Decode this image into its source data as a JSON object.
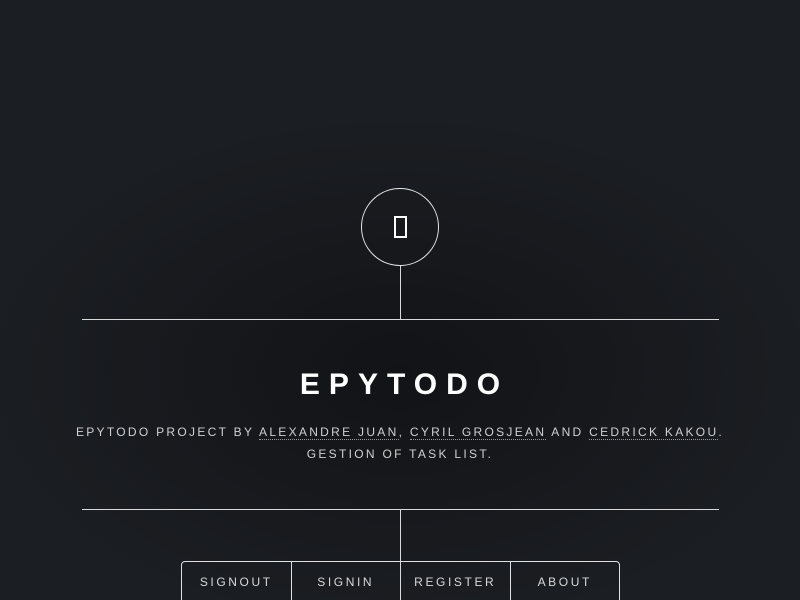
{
  "header": {
    "logo_icon": "square-outline-icon",
    "title": "EPYTODO",
    "description": {
      "prefix": "Epytodo project by ",
      "author1": "Alexandre Juan",
      "sep1": ", ",
      "author2": "Cyril Grosjean",
      "sep2": " and ",
      "author3": "Cedrick Kakou",
      "suffix": ".",
      "line2": "Gestion of task list."
    }
  },
  "nav": {
    "items": [
      {
        "label": "Signout"
      },
      {
        "label": "Signin"
      },
      {
        "label": "Register"
      },
      {
        "label": "About"
      }
    ]
  }
}
